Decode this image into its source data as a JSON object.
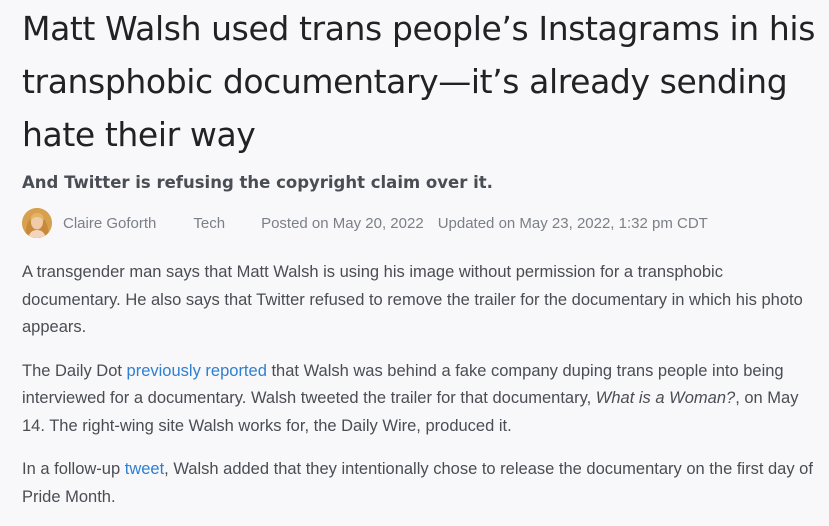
{
  "article": {
    "headline": "Matt Walsh used trans people’s Instagrams in his transphobic documentary—it’s already sending hate their way",
    "subheadline": "And Twitter is refusing the copyright claim over it.",
    "byline": {
      "author": "Claire Goforth",
      "category": "Tech",
      "posted": "Posted on May 20, 2022",
      "updated": "Updated on May 23, 2022, 1:32 pm CDT"
    },
    "paragraphs": [
      {
        "text": "A transgender man says that Matt Walsh is using his image without permission for a transphobic documentary. He also says that Twitter refused to remove the trailer for the documentary in which his photo appears."
      },
      {
        "before_link": "The Daily Dot ",
        "link": "previously reported",
        "after_link": " that Walsh was behind a fake company duping trans people into being interviewed for a documentary. Walsh tweeted the trailer for that documentary, ",
        "italic": "What is a Woman?",
        "after_italic": ", on May 14. The right-wing site Walsh works for, the Daily Wire, produced it."
      },
      {
        "before_link": "In a follow-up ",
        "link": "tweet",
        "after_link": ", Walsh added that they intentionally chose to release the documentary on the first day of Pride Month."
      }
    ]
  },
  "colors": {
    "background": "#f8f8fa",
    "headline": "#222226",
    "body": "#4a4d54",
    "meta": "#7b7f88",
    "link": "#2d7fd0"
  },
  "icons": {
    "avatar": "author-avatar-photo"
  }
}
